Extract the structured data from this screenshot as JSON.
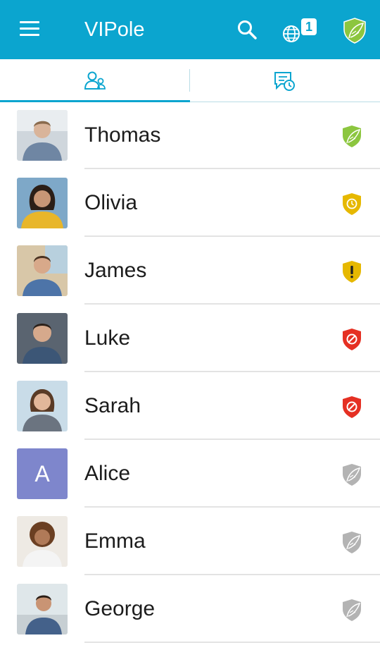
{
  "app": {
    "title": "VIPole",
    "notification_count": "1"
  },
  "icons": {
    "menu": "hamburger-menu-icon",
    "search": "search-icon",
    "globe": "globe-icon",
    "status": "green-leaf-shield-icon",
    "tab_contacts": "contacts-icon",
    "tab_chats": "chat-history-icon"
  },
  "colors": {
    "accent": "#0ba5cf",
    "trusted": "#8cc63f",
    "pending": "#e6b800",
    "warning": "#e6b800",
    "blocked": "#e53023",
    "unknown": "#b3b3b3",
    "letter_avatar": "#7e86cc"
  },
  "contacts": [
    {
      "name": "Thomas",
      "status": "trusted"
    },
    {
      "name": "Olivia",
      "status": "pending"
    },
    {
      "name": "James",
      "status": "warning"
    },
    {
      "name": "Luke",
      "status": "blocked"
    },
    {
      "name": "Sarah",
      "status": "blocked"
    },
    {
      "name": "Alice",
      "status": "unknown",
      "initial": "A"
    },
    {
      "name": "Emma",
      "status": "unknown"
    },
    {
      "name": "George",
      "status": "unknown"
    }
  ]
}
